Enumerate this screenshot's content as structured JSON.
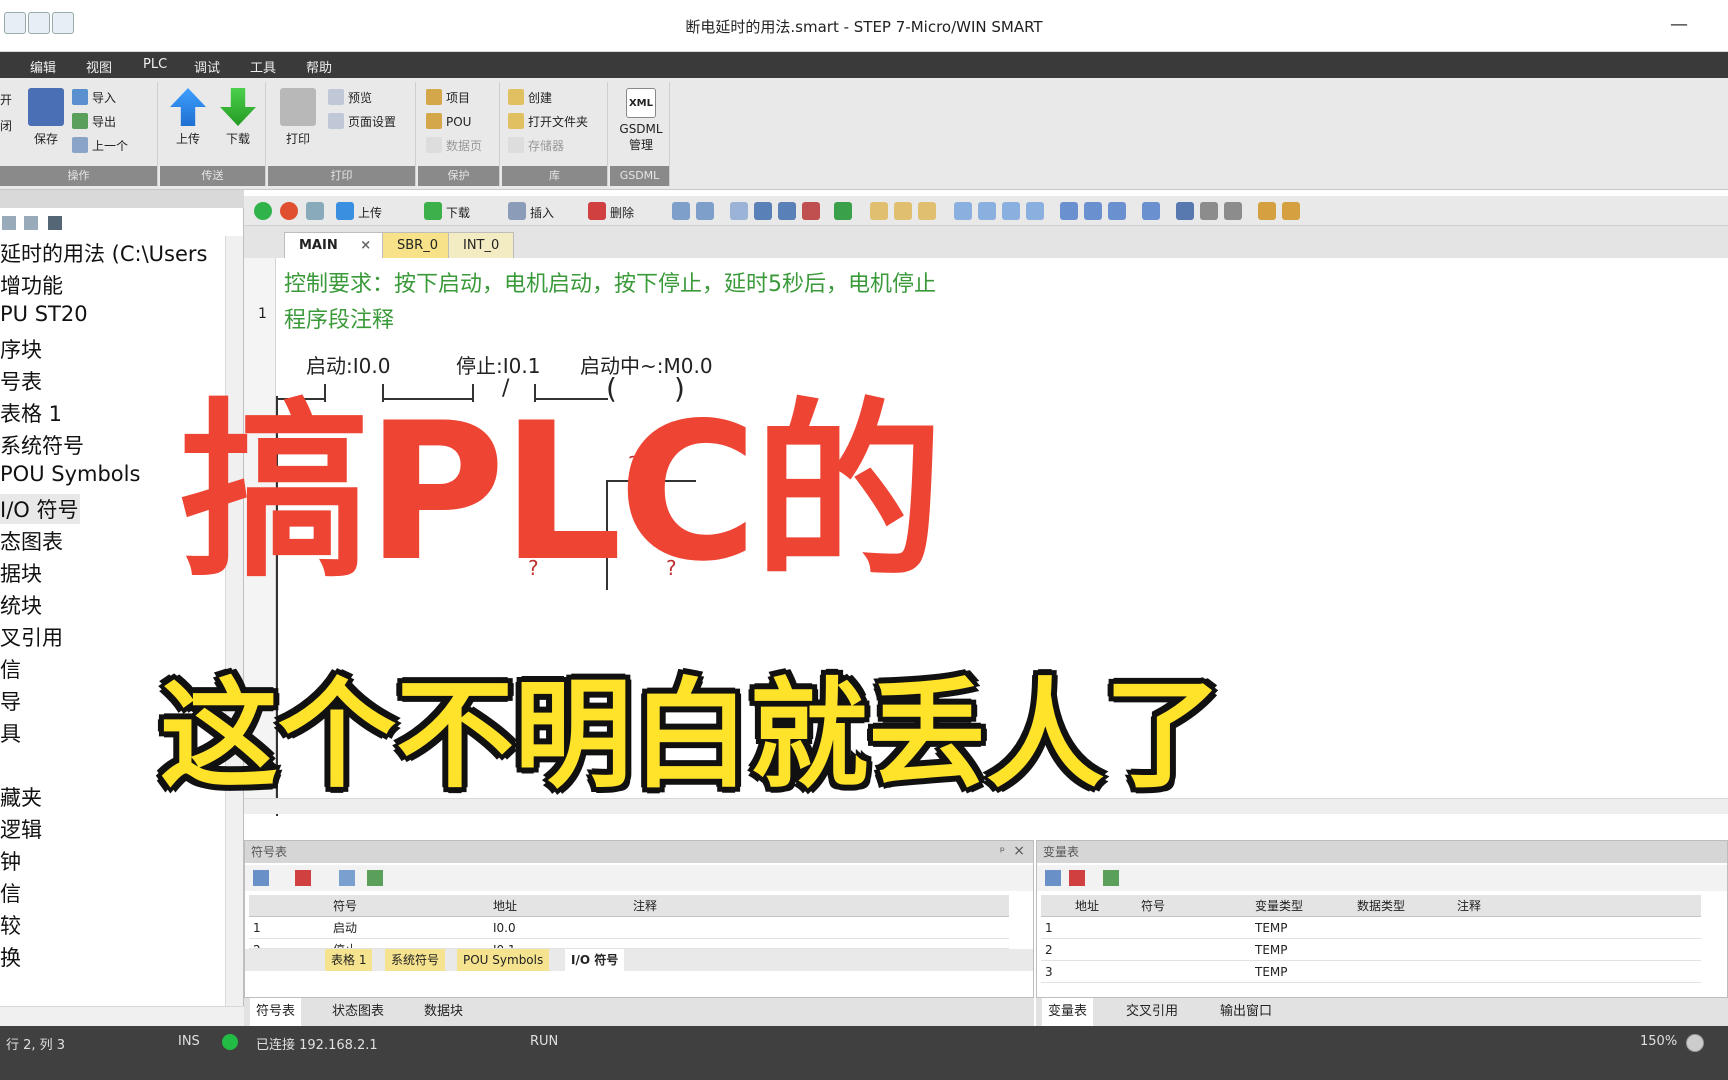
{
  "window": {
    "title": "断电延时的用法.smart - STEP 7-Micro/WIN SMART",
    "minimize_glyph": "—"
  },
  "menu": [
    "编辑",
    "视图",
    "PLC",
    "调试",
    "工具",
    "帮助"
  ],
  "ribbon": {
    "groups": [
      {
        "label": "操作",
        "items": [
          "开",
          "闭",
          "保存",
          "导入",
          "导出",
          "上一个"
        ]
      },
      {
        "label": "传送",
        "items": [
          "上传",
          "下载"
        ]
      },
      {
        "label": "打印",
        "items": [
          "打印",
          "预览",
          "页面设置"
        ]
      },
      {
        "label": "保护",
        "items": [
          "项目",
          "POU",
          "数据页"
        ]
      },
      {
        "label": "库",
        "items": [
          "创建",
          "打开文件夹",
          "存储器"
        ]
      },
      {
        "label": "GSDML",
        "items": [
          "XML",
          "GSDML",
          "管理"
        ]
      }
    ]
  },
  "project_tree": {
    "items": [
      "延时的用法 (C:\\Users",
      "增功能",
      "PU ST20",
      "序块",
      "号表",
      "表格 1",
      "系统符号",
      "POU Symbols",
      "I/O 符号",
      "态图表",
      "据块",
      "统块",
      "叉引用",
      "信",
      "导",
      "具",
      "藏夹",
      "逻辑",
      "钟",
      "信",
      "较",
      "换"
    ]
  },
  "editor_toolbar": {
    "labels": [
      "上传",
      "下载",
      "插入",
      "删除"
    ]
  },
  "editor_tabs": [
    "MAIN",
    "SBR_0",
    "INT_0"
  ],
  "editor": {
    "comment": "控制要求：按下启动，电机启动，按下停止，延时5秒后，电机停止",
    "network_number": "1",
    "network_comment": "程序段注释",
    "contacts": [
      "启动:I0.0",
      "停止:I0.1",
      "启动中~:M0.0"
    ],
    "nc_mark": "/",
    "unknown_operand": "????",
    "question_marks": [
      "?",
      "?"
    ]
  },
  "overlay": {
    "line1": "搞PLC的",
    "line2": "这个不明白就丢人了"
  },
  "symbol_table": {
    "title": "符号表",
    "headers": [
      "符号",
      "地址",
      "注释"
    ],
    "rows": [
      {
        "num": "1",
        "symbol": "启动",
        "address": "I0.0"
      },
      {
        "num": "2",
        "symbol": "停止",
        "address": "I0.1"
      }
    ],
    "subtabs": [
      "表格 1",
      "系统符号",
      "POU Symbols",
      "I/O 符号"
    ]
  },
  "variable_table": {
    "title": "变量表",
    "headers": [
      "地址",
      "符号",
      "变量类型",
      "数据类型",
      "注释"
    ],
    "rows": [
      {
        "num": "1",
        "type": "TEMP"
      },
      {
        "num": "2",
        "type": "TEMP"
      },
      {
        "num": "3",
        "type": "TEMP"
      }
    ]
  },
  "bottom_tabs_left": [
    "符号表",
    "状态图表",
    "数据块"
  ],
  "bottom_tabs_right": [
    "变量表",
    "交叉引用",
    "输出窗口"
  ],
  "statusbar": {
    "position": "行 2, 列 3",
    "mode": "INS",
    "connection": "已连接 192.168.2.1",
    "plc_state": "RUN",
    "zoom": "150%"
  },
  "colors": {
    "accent_red": "#ee4433",
    "accent_yellow": "#ffe22a",
    "comment_green": "#3a9a3a",
    "menubar": "#3a3a3a",
    "status_ok": "#22bb44"
  }
}
